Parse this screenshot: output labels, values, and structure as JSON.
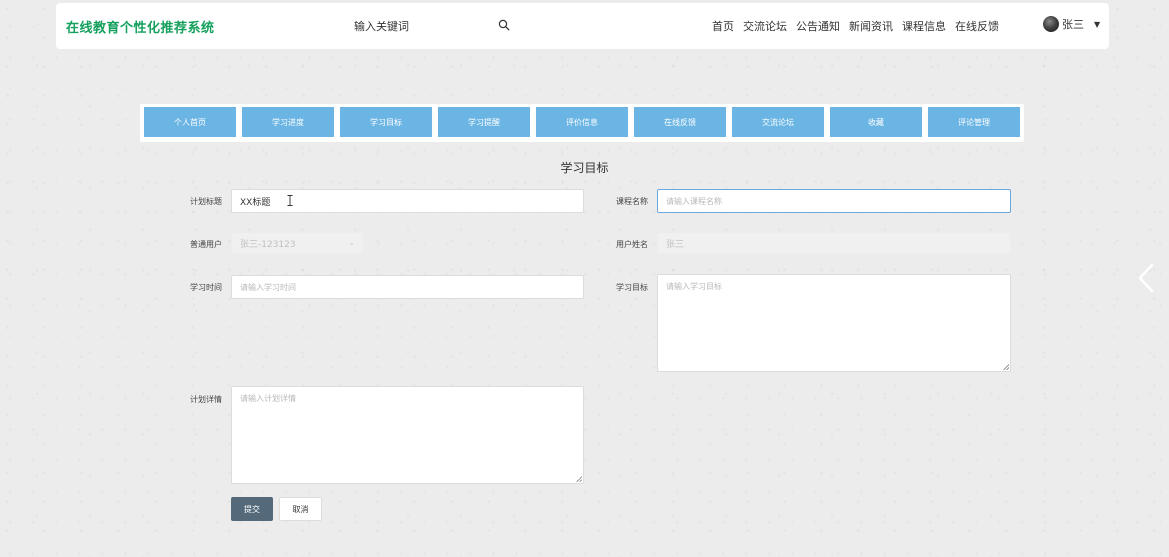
{
  "header": {
    "logo": "在线教育个性化推荐系统",
    "search_placeholder": "输入关键词",
    "nav": [
      "首页",
      "交流论坛",
      "公告通知",
      "新闻资讯",
      "课程信息",
      "在线反馈"
    ],
    "user_name": "张三"
  },
  "tabs": [
    "个人首页",
    "学习进度",
    "学习目标",
    "学习提醒",
    "评价信息",
    "在线反馈",
    "交流论坛",
    "收藏",
    "评论管理"
  ],
  "form": {
    "title": "学习目标",
    "plan_title_label": "计划标题",
    "plan_title_value": "XX标题",
    "course_name_label": "课程名称",
    "course_name_placeholder": "请输入课程名称",
    "user_label": "普通用户",
    "user_value": "张三-123123",
    "user_name_label": "用户姓名",
    "user_name_value": "张三",
    "study_time_label": "学习时间",
    "study_time_placeholder": "请输入学习时间",
    "study_goal_label": "学习目标",
    "study_goal_placeholder": "请输入学习目标",
    "plan_detail_label": "计划详情",
    "plan_detail_placeholder": "请输入计划详情",
    "submit_label": "提交",
    "cancel_label": "取消"
  },
  "colors": {
    "logo": "#15a05e",
    "tab_bg": "#6bb5e4",
    "submit_bg": "#546a7b",
    "focus_border": "#6aa8e4"
  }
}
